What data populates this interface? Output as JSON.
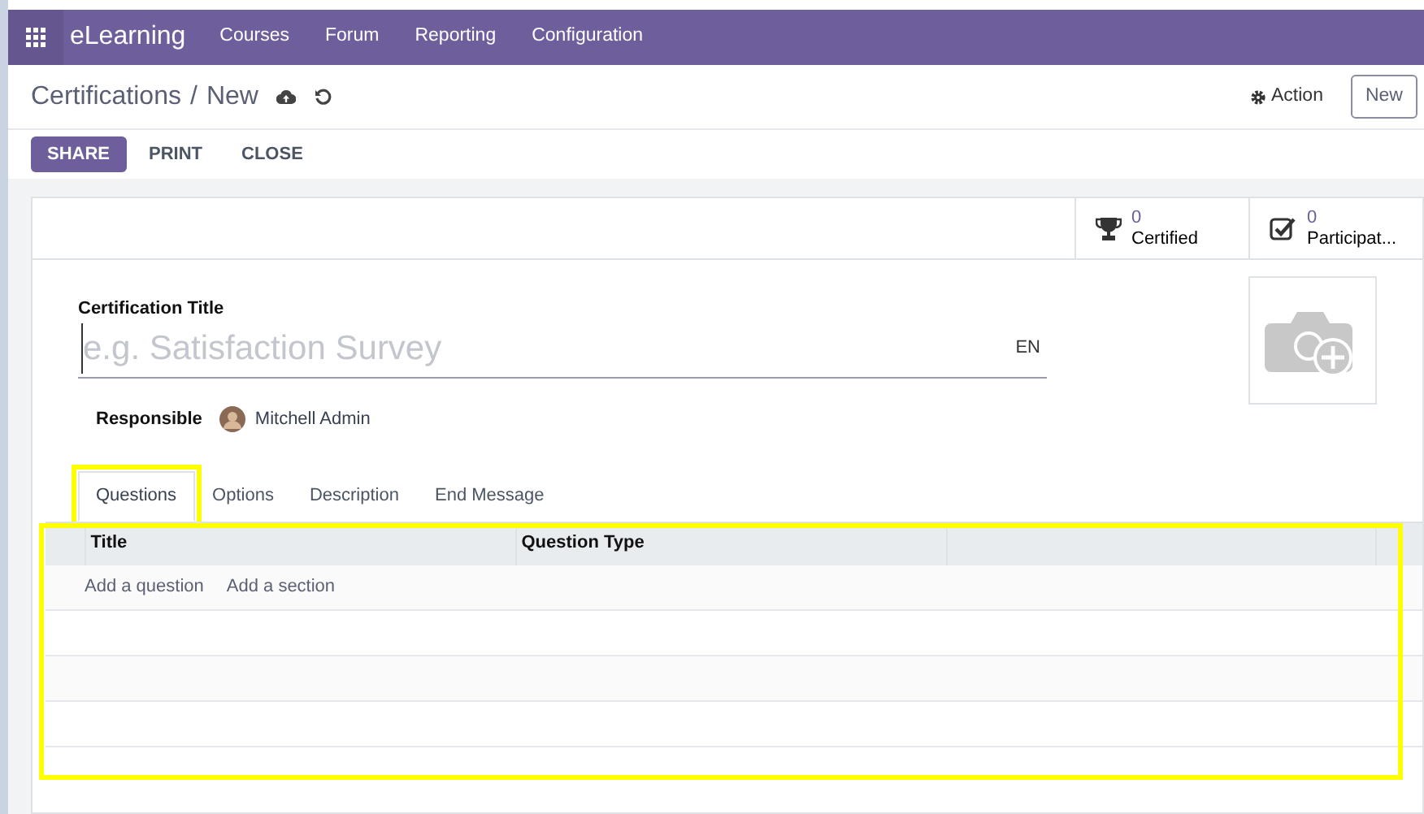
{
  "navbar": {
    "app": "eLearning",
    "menus": [
      "Courses",
      "Forum",
      "Reporting",
      "Configuration"
    ]
  },
  "breadcrumb": {
    "parent": "Certifications",
    "separator": "/",
    "current": "New"
  },
  "control_panel": {
    "action": "Action",
    "new_button": "New"
  },
  "status_buttons": [
    {
      "label": "SHARE",
      "kind": "primary"
    },
    {
      "label": "PRINT",
      "kind": "plain"
    },
    {
      "label": "CLOSE",
      "kind": "plain"
    }
  ],
  "stats": [
    {
      "kind": "trophy",
      "value": "0",
      "label": "Certified"
    },
    {
      "kind": "check",
      "value": "0",
      "label": "Participat..."
    }
  ],
  "form": {
    "title_label": "Certification Title",
    "title_placeholder": "e.g. Satisfaction Survey",
    "language": "EN",
    "responsible_label": "Responsible",
    "responsible": "Mitchell Admin"
  },
  "tabs": [
    {
      "label": "Questions",
      "selected": true,
      "highlighted": true
    },
    {
      "label": "Options",
      "selected": false,
      "highlighted": false
    },
    {
      "label": "Description",
      "selected": false,
      "highlighted": false
    },
    {
      "label": "End Message",
      "selected": false,
      "highlighted": false
    }
  ],
  "table": {
    "highlighted": true,
    "columns": [
      "Title",
      "Question Type"
    ],
    "add_links": [
      "Add a question",
      "Add a section"
    ]
  }
}
